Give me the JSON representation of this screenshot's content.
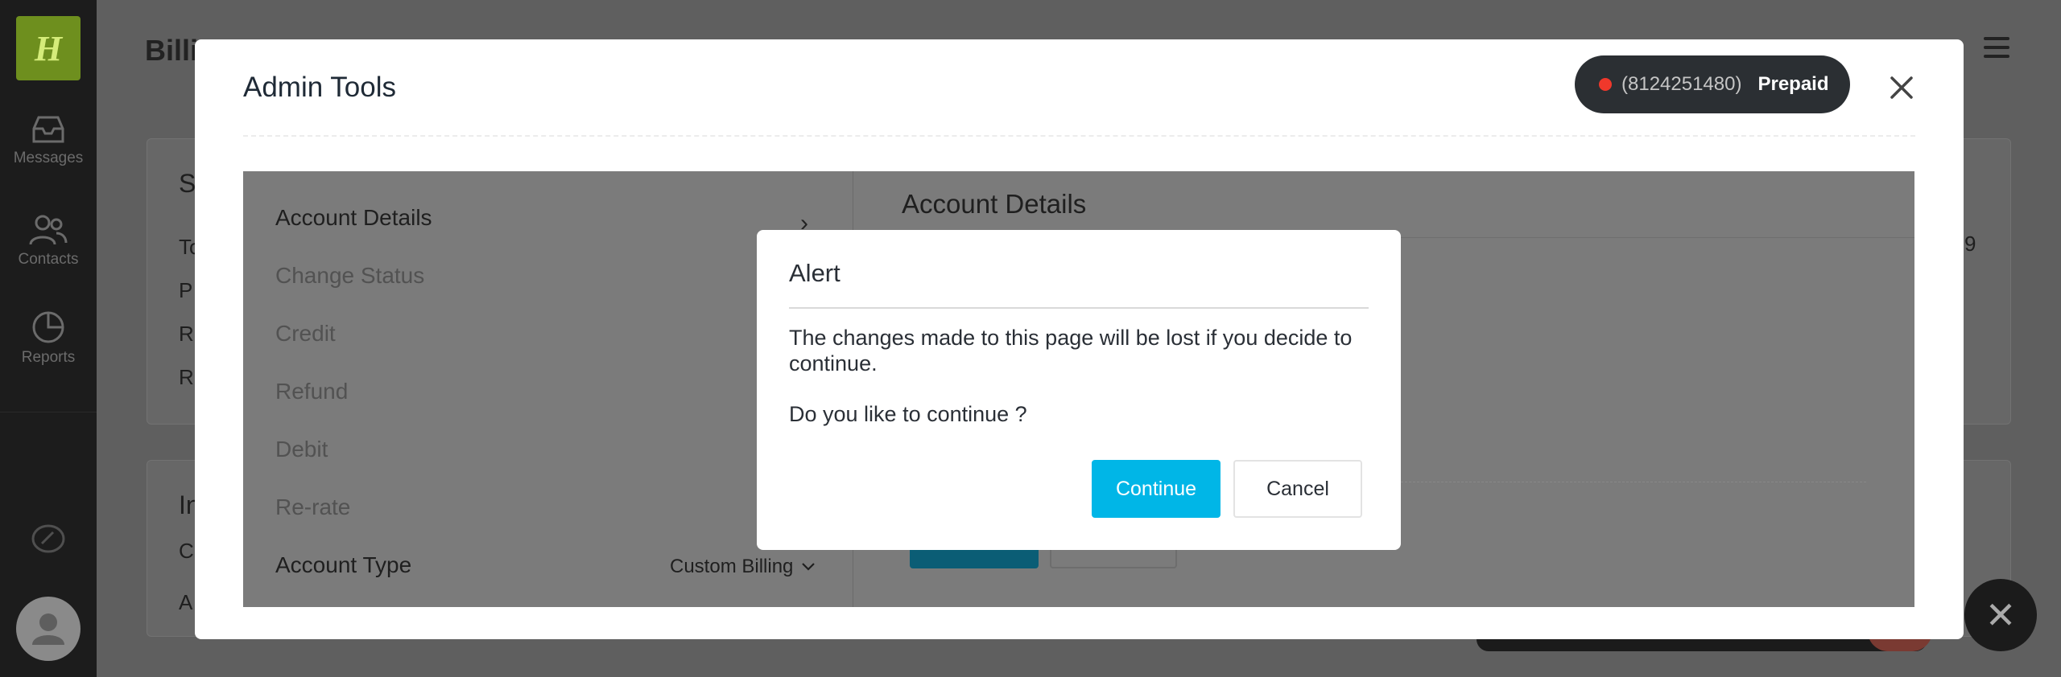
{
  "app": {
    "logo_letter": "H",
    "title": "Billi",
    "sidebar": [
      {
        "label": "Messages",
        "icon": "inbox-icon"
      },
      {
        "label": "Contacts",
        "icon": "users-icon"
      },
      {
        "label": "Reports",
        "icon": "pie-chart-icon"
      }
    ],
    "bg_text": {
      "card1_heading": "S",
      "card1_rows": [
        "To",
        "P",
        "R",
        "R"
      ],
      "card2_heading": "In",
      "card2_rows": [
        "C",
        "A"
      ],
      "right_value": "9"
    }
  },
  "admin_modal": {
    "title": "Admin Tools",
    "status_phone": "(8124251480)",
    "status_plan": "Prepaid",
    "menu": [
      {
        "label": "Account Details",
        "active": true
      },
      {
        "label": "Change Status",
        "active": false
      },
      {
        "label": "Credit",
        "active": false
      },
      {
        "label": "Refund",
        "active": false
      },
      {
        "label": "Debit",
        "active": false
      },
      {
        "label": "Re-rate",
        "active": false
      }
    ],
    "account_type_label": "Account Type",
    "account_type_value": "Custom Billing",
    "detail_title": "Account Details"
  },
  "alert": {
    "title": "Alert",
    "message": "The changes made to this page will be lost if you decide to continue.",
    "question": "Do you like to continue ?",
    "continue_label": "Continue",
    "cancel_label": "Cancel"
  },
  "colors": {
    "accent": "#00b6e7",
    "status_dot": "#f0382b",
    "pill_bg": "#2b2f33"
  }
}
